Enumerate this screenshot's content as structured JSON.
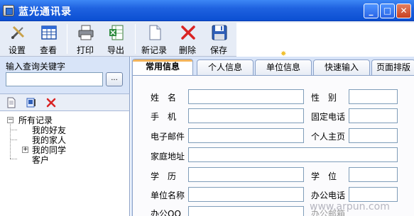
{
  "window": {
    "title": "蓝光通讯录",
    "controls": {
      "minimize": "_",
      "maximize": "□",
      "close": "✕"
    }
  },
  "toolbar": {
    "buttons": [
      {
        "label": "设置",
        "icon": "wrench-screwdriver-icon"
      },
      {
        "label": "查看",
        "icon": "grid-view-icon"
      },
      {
        "label": "打印",
        "icon": "printer-icon"
      },
      {
        "label": "导出",
        "icon": "excel-export-icon"
      },
      {
        "label": "新记录",
        "icon": "new-document-icon"
      },
      {
        "label": "删除",
        "icon": "delete-x-icon"
      },
      {
        "label": "保存",
        "icon": "floppy-disk-icon"
      }
    ]
  },
  "search": {
    "label": "输入查询关键字",
    "value": "",
    "button_label": "..."
  },
  "tree": {
    "root": {
      "label": "所有记录",
      "expander": "−"
    },
    "children": [
      {
        "label": "我的好友"
      },
      {
        "label": "我的家人"
      },
      {
        "label": "我的同学",
        "expander": "+"
      },
      {
        "label": "客户"
      }
    ]
  },
  "tabs": [
    {
      "label": "常用信息",
      "active": true
    },
    {
      "label": "个人信息"
    },
    {
      "label": "单位信息"
    },
    {
      "label": "快速输入"
    },
    {
      "label": "页面排版"
    }
  ],
  "form": {
    "name": "姓　名",
    "gender": "性　别",
    "mobile": "手　机",
    "landline": "固定电话",
    "email": "电子邮件",
    "homepage": "个人主页",
    "home_address": "家庭地址",
    "education": "学　历",
    "degree": "学　位",
    "company_name": "单位名称",
    "office_phone": "办公电话",
    "office_qq": "办公QQ",
    "office_email": "办公邮箱"
  },
  "watermark": "www.arpun.com",
  "colors": {
    "titlebar": "#0b4fd2",
    "panel": "#d8e4f8",
    "active_tab_accent": "#f3b45a",
    "delete_red": "#d92323"
  }
}
